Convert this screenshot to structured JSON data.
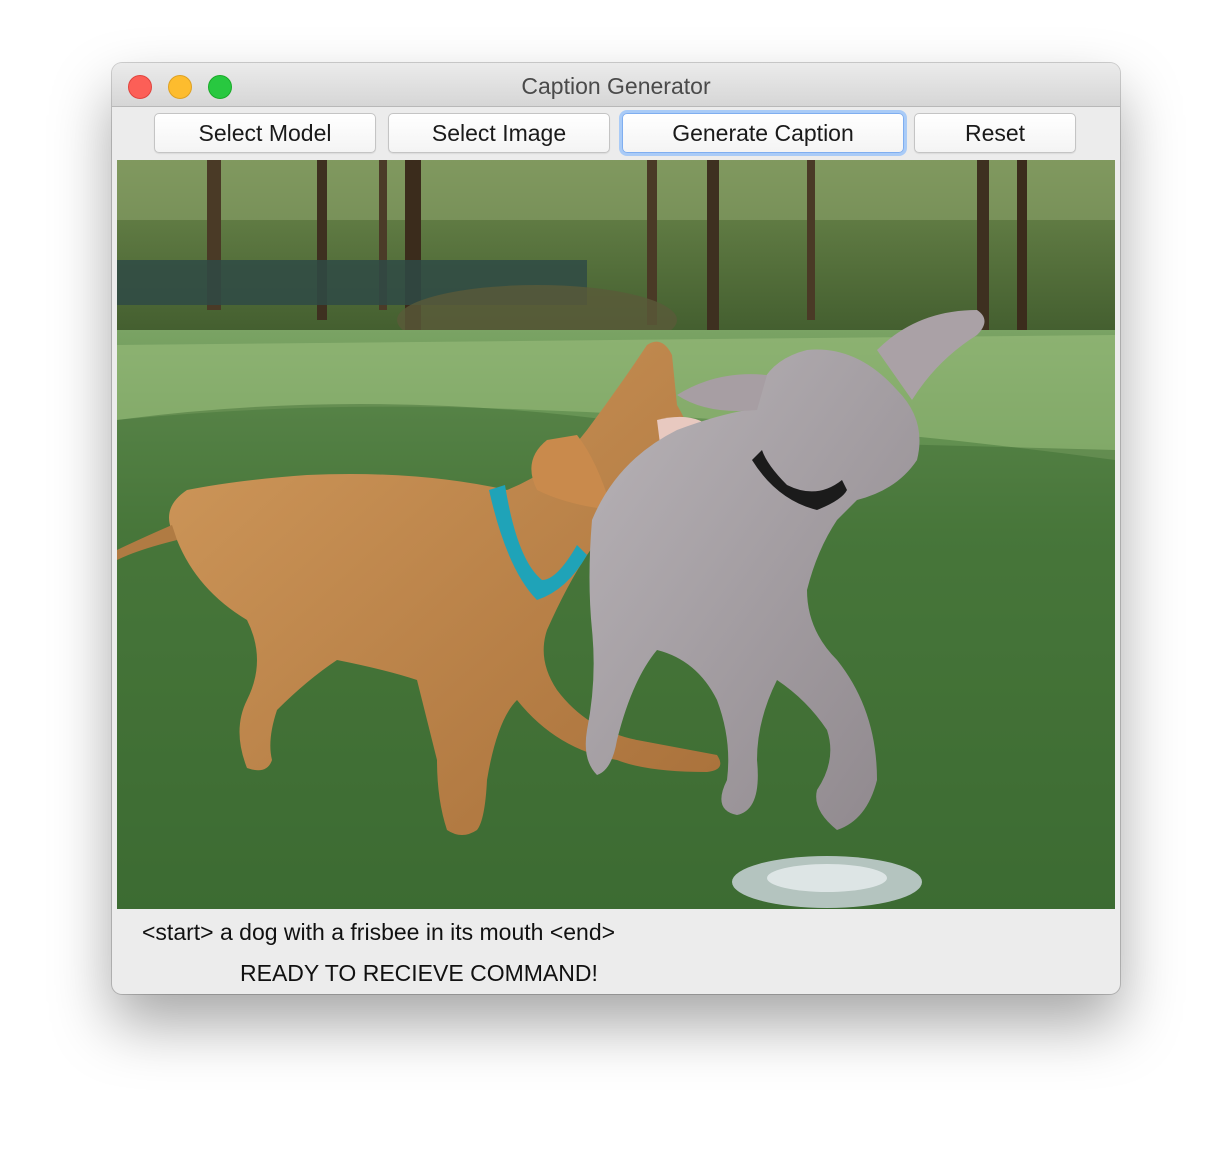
{
  "window": {
    "title": "Caption Generator"
  },
  "toolbar": {
    "buttons": [
      {
        "label": "Select Model"
      },
      {
        "label": "Select Image"
      },
      {
        "label": "Generate Caption"
      },
      {
        "label": "Reset"
      }
    ]
  },
  "image": {
    "subject": "two puppies playing on grass"
  },
  "output": {
    "caption": "<start> a dog with a frisbee in its mouth <end>",
    "status": "READY TO RECIEVE COMMAND!"
  },
  "colors": {
    "close": "#fc5f57",
    "minimize": "#fdbc2e",
    "maximize": "#28c840",
    "focus_ring": "#a9cbf7"
  }
}
